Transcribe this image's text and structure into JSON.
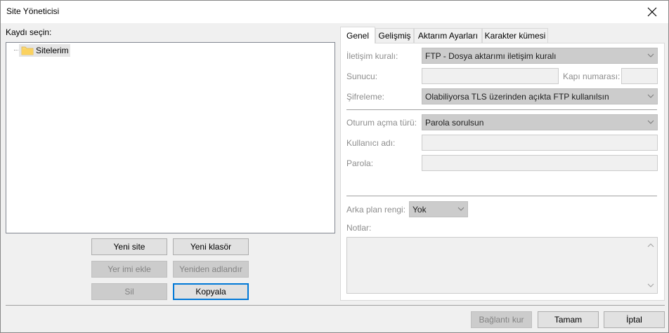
{
  "window": {
    "title": "Site Yöneticisi",
    "close_glyph": "✕"
  },
  "left": {
    "select_label": "Kaydı seçin:",
    "tree": {
      "root_label": "Sitelerim",
      "root_icon": "folder-icon"
    },
    "buttons": {
      "new_site": "Yeni site",
      "new_folder": "Yeni klasör",
      "add_bookmark": "Yer imi ekle",
      "rename": "Yeniden adlandır",
      "delete": "Sil",
      "copy": "Kopyala"
    }
  },
  "tabs": [
    {
      "label": "Genel",
      "active": true
    },
    {
      "label": "Gelişmiş",
      "active": false
    },
    {
      "label": "Aktarım Ayarları",
      "active": false
    },
    {
      "label": "Karakter kümesi",
      "active": false
    }
  ],
  "general": {
    "protocol_label": "İletişim kuralı:",
    "protocol_value": "FTP - Dosya aktarımı iletişim kuralı",
    "host_label": "Sunucu:",
    "host_value": "",
    "port_label": "Kapı numarası:",
    "port_value": "",
    "encryption_label": "Şifreleme:",
    "encryption_value": "Olabiliyorsa TLS üzerinden açıkta FTP kullanılsın",
    "logon_type_label": "Oturum açma türü:",
    "logon_type_value": "Parola sorulsun",
    "user_label": "Kullanıcı adı:",
    "user_value": "",
    "password_label": "Parola:",
    "password_value": "",
    "bg_color_label": "Arka plan rengi:",
    "bg_color_value": "Yok",
    "notes_label": "Notlar:",
    "notes_value": ""
  },
  "footer": {
    "connect": "Bağlantı kur",
    "ok": "Tamam",
    "cancel": "İptal"
  },
  "colors": {
    "window_bg": "#f0f0f0",
    "default_button_border": "#0078d7",
    "disabled_text": "#838383",
    "folder_yellow": "#f8d775"
  }
}
